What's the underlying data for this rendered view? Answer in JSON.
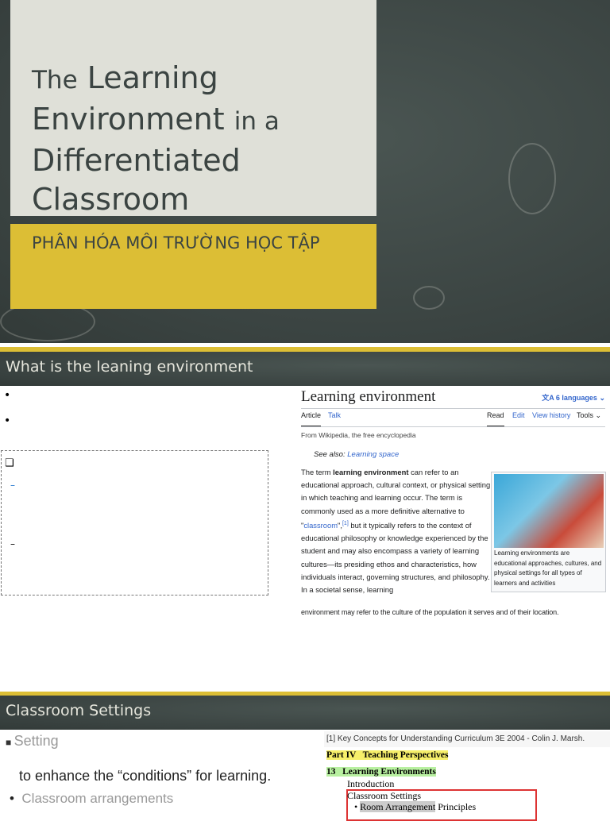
{
  "slide1": {
    "title_parts": [
      "The",
      "Learning",
      "Environment",
      "in a",
      "Differentiated",
      "Classroom"
    ],
    "subtitle": "PHÂN HÓA MÔI TRƯỜNG HỌC TẬP"
  },
  "slide2": {
    "header": "What is the leaning environment",
    "bullet_glyph": "•",
    "checkbox_glyph": "❑",
    "dash_glyph": "–",
    "wiki": {
      "title": "Learning environment",
      "languages": "6 languages",
      "tabs_left": [
        "Article",
        "Talk"
      ],
      "tabs_right": [
        "Read",
        "Edit",
        "View history",
        "Tools"
      ],
      "from": "From Wikipedia, the free encyclopedia",
      "see_also_label": "See also:",
      "see_also_link": "Learning space",
      "body_pre": "The term ",
      "body_bold": "learning environment",
      "body_mid": " can refer to an educational approach, cultural context, or physical setting in which teaching and learning occur. The term is commonly used as a more definitive alternative to \"",
      "body_link": "classroom",
      "body_ref": "[1]",
      "body_post": " but it typically refers to the context of educational philosophy or knowledge experienced by the student and may also encompass a variety of learning cultures—its presiding ethos and characteristics, how individuals interact, governing structures, and philosophy. In a societal sense, learning",
      "body_last": "environment may refer to the culture of the population it serves and of their location.",
      "caption": "Learning environments are educational approaches, cultures, and physical settings for all types of learners and activities"
    }
  },
  "slide3": {
    "header": "Classroom Settings",
    "items": [
      "Setting",
      "to enhance the “conditions” for learning.",
      "Classroom arrangements"
    ],
    "ref": {
      "citation": "[1] Key Concepts for Understanding Curriculum 3E 2004 -  Colin J. Marsh.",
      "part": "Part IV   Teaching Perspectives",
      "chapter": "13   Learning Environments",
      "intro": "Introduction",
      "section": "Classroom Settings",
      "sub_highlight": "Room Arrangement",
      "sub_rest": " Principles"
    }
  },
  "colors": {
    "accent_yellow": "#dcbe35",
    "board": "#3d4644"
  }
}
